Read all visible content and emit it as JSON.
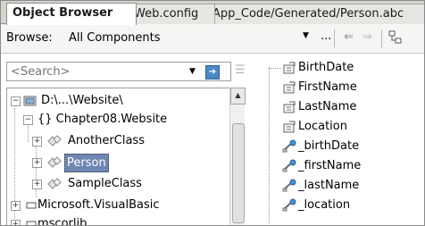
{
  "tabs": [
    {
      "label": "Object Browser"
    },
    {
      "label": "Web.config"
    },
    {
      "label": "App_Code/Generated/Person.abc"
    }
  ],
  "toolbar": {
    "browse_label": "Browse:",
    "browse_value": "All Components",
    "ellipsis": "..."
  },
  "search": {
    "placeholder": "<Search>"
  },
  "tree": {
    "items": [
      {
        "label": "D:\\...\\Website\\",
        "icon": "project-icon"
      },
      {
        "label": "{} Chapter08.Website",
        "icon": "namespace-icon"
      },
      {
        "label": "AnotherClass",
        "icon": "class-icon"
      },
      {
        "label": "Person",
        "icon": "class-icon",
        "selected": true
      },
      {
        "label": "SampleClass",
        "icon": "class-icon"
      },
      {
        "label": "Microsoft.VisualBasic",
        "icon": "assembly-icon"
      },
      {
        "label": "mscorlib",
        "icon": "assembly-icon"
      }
    ]
  },
  "members": {
    "items": [
      {
        "label": "BirthDate",
        "icon": "property-icon"
      },
      {
        "label": "FirstName",
        "icon": "property-icon"
      },
      {
        "label": "LastName",
        "icon": "property-icon"
      },
      {
        "label": "Location",
        "icon": "property-icon"
      },
      {
        "label": "_birthDate",
        "icon": "field-icon"
      },
      {
        "label": "_firstName",
        "icon": "field-icon"
      },
      {
        "label": "_lastName",
        "icon": "field-icon"
      },
      {
        "label": "_location",
        "icon": "field-icon"
      }
    ]
  },
  "colors": {
    "selection": "#6e87b3",
    "tab_strip": "#d6d3ce"
  }
}
